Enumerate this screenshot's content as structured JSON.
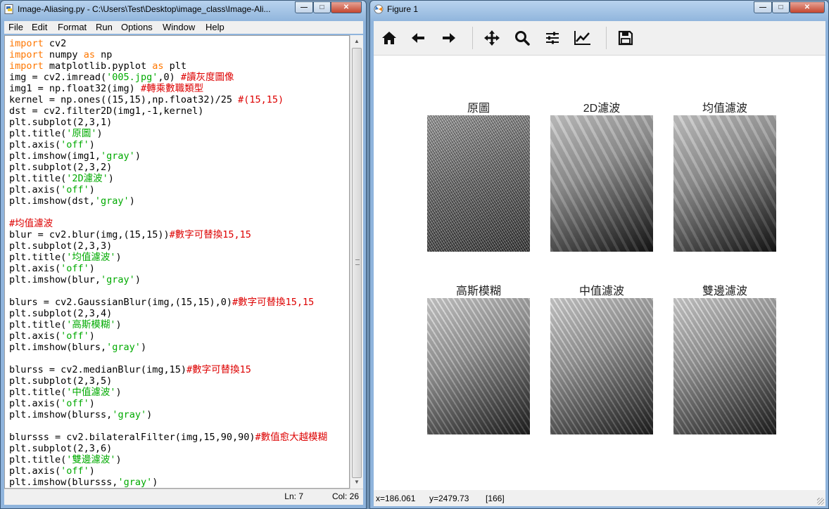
{
  "idle": {
    "title": "Image-Aliasing.py - C:\\Users\\Test\\Desktop\\image_class\\Image-Ali...",
    "menu": [
      "File",
      "Edit",
      "Format",
      "Run",
      "Options",
      "Window",
      "Help"
    ],
    "code_lines": [
      [
        [
          "kw",
          "import"
        ],
        [
          "n",
          " cv2"
        ]
      ],
      [
        [
          "kw",
          "import"
        ],
        [
          "n",
          " numpy "
        ],
        [
          "kw",
          "as"
        ],
        [
          "n",
          " np"
        ]
      ],
      [
        [
          "kw",
          "import"
        ],
        [
          "n",
          " matplotlib.pyplot "
        ],
        [
          "kw",
          "as"
        ],
        [
          "n",
          " plt"
        ]
      ],
      [
        [
          "n",
          "img = cv2.imread("
        ],
        [
          "str",
          "'005.jpg'"
        ],
        [
          "n",
          ",0) "
        ],
        [
          "cmt",
          "#讀灰度圖像"
        ]
      ],
      [
        [
          "n",
          "img1 = np.float32(img) "
        ],
        [
          "cmt",
          "#轉乘數職類型"
        ]
      ],
      [
        [
          "n",
          "kernel = np.ones((15,15),np.float32)/25 "
        ],
        [
          "cmt",
          "#(15,15)"
        ]
      ],
      [
        [
          "n",
          "dst = cv2.filter2D(img1,-1,kernel)"
        ]
      ],
      [
        [
          "n",
          "plt.subplot(2,3,1)"
        ]
      ],
      [
        [
          "n",
          "plt.title("
        ],
        [
          "str",
          "'原圖'"
        ],
        [
          "n",
          ")"
        ]
      ],
      [
        [
          "n",
          "plt.axis("
        ],
        [
          "str",
          "'off'"
        ],
        [
          "n",
          ")"
        ]
      ],
      [
        [
          "n",
          "plt.imshow(img1,"
        ],
        [
          "str",
          "'gray'"
        ],
        [
          "n",
          ")"
        ]
      ],
      [
        [
          "n",
          "plt.subplot(2,3,2)"
        ]
      ],
      [
        [
          "n",
          "plt.title("
        ],
        [
          "str",
          "'2D濾波'"
        ],
        [
          "n",
          ")"
        ]
      ],
      [
        [
          "n",
          "plt.axis("
        ],
        [
          "str",
          "'off'"
        ],
        [
          "n",
          ")"
        ]
      ],
      [
        [
          "n",
          "plt.imshow(dst,"
        ],
        [
          "str",
          "'gray'"
        ],
        [
          "n",
          ")"
        ]
      ],
      [
        [
          "n",
          ""
        ]
      ],
      [
        [
          "cmt",
          "#均值濾波"
        ]
      ],
      [
        [
          "n",
          "blur = cv2.blur(img,(15,15))"
        ],
        [
          "cmt",
          "#數字可替換15,15"
        ]
      ],
      [
        [
          "n",
          "plt.subplot(2,3,3)"
        ]
      ],
      [
        [
          "n",
          "plt.title("
        ],
        [
          "str",
          "'均值濾波'"
        ],
        [
          "n",
          ")"
        ]
      ],
      [
        [
          "n",
          "plt.axis("
        ],
        [
          "str",
          "'off'"
        ],
        [
          "n",
          ")"
        ]
      ],
      [
        [
          "n",
          "plt.imshow(blur,"
        ],
        [
          "str",
          "'gray'"
        ],
        [
          "n",
          ")"
        ]
      ],
      [
        [
          "n",
          ""
        ]
      ],
      [
        [
          "n",
          "blurs = cv2.GaussianBlur(img,(15,15),0)"
        ],
        [
          "cmt",
          "#數字可替換15,15"
        ]
      ],
      [
        [
          "n",
          "plt.subplot(2,3,4)"
        ]
      ],
      [
        [
          "n",
          "plt.title("
        ],
        [
          "str",
          "'高斯模糊'"
        ],
        [
          "n",
          ")"
        ]
      ],
      [
        [
          "n",
          "plt.axis("
        ],
        [
          "str",
          "'off'"
        ],
        [
          "n",
          ")"
        ]
      ],
      [
        [
          "n",
          "plt.imshow(blurs,"
        ],
        [
          "str",
          "'gray'"
        ],
        [
          "n",
          ")"
        ]
      ],
      [
        [
          "n",
          ""
        ]
      ],
      [
        [
          "n",
          "blurss = cv2.medianBlur(img,15)"
        ],
        [
          "cmt",
          "#數字可替換15"
        ]
      ],
      [
        [
          "n",
          "plt.subplot(2,3,5)"
        ]
      ],
      [
        [
          "n",
          "plt.title("
        ],
        [
          "str",
          "'中值濾波'"
        ],
        [
          "n",
          ")"
        ]
      ],
      [
        [
          "n",
          "plt.axis("
        ],
        [
          "str",
          "'off'"
        ],
        [
          "n",
          ")"
        ]
      ],
      [
        [
          "n",
          "plt.imshow(blurss,"
        ],
        [
          "str",
          "'gray'"
        ],
        [
          "n",
          ")"
        ]
      ],
      [
        [
          "n",
          ""
        ]
      ],
      [
        [
          "n",
          "blursss = cv2.bilateralFilter(img,15,90,90)"
        ],
        [
          "cmt",
          "#數值愈大越模糊"
        ]
      ],
      [
        [
          "n",
          "plt.subplot(2,3,6)"
        ]
      ],
      [
        [
          "n",
          "plt.title("
        ],
        [
          "str",
          "'雙邊濾波'"
        ],
        [
          "n",
          ")"
        ]
      ],
      [
        [
          "n",
          "plt.axis("
        ],
        [
          "str",
          "'off'"
        ],
        [
          "n",
          ")"
        ]
      ],
      [
        [
          "n",
          "plt.imshow(blursss,"
        ],
        [
          "str",
          "'gray'"
        ],
        [
          "n",
          ")"
        ]
      ]
    ],
    "status": {
      "line": "Ln: 7",
      "col": "Col: 26"
    }
  },
  "figure": {
    "title": "Figure 1",
    "toolbar_icons": [
      "home-icon",
      "back-arrow-icon",
      "forward-arrow-icon",
      "pan-move-icon",
      "zoom-magnifier-icon",
      "subplots-config-icon",
      "edit-axes-curve-icon",
      "save-floppy-icon"
    ],
    "subplots": [
      {
        "title": "原圖",
        "texture": "alias"
      },
      {
        "title": "2D濾波",
        "texture": "smooth"
      },
      {
        "title": "均值濾波",
        "texture": "smooth"
      },
      {
        "title": "高斯模糊",
        "texture": "gauss"
      },
      {
        "title": "中值濾波",
        "texture": "gauss"
      },
      {
        "title": "雙邊濾波",
        "texture": "gauss"
      }
    ],
    "status": {
      "x": "x=186.061",
      "y": "y=2479.73",
      "value": "[166]"
    }
  },
  "colors": {
    "keyword": "#ff7700",
    "string": "#00aa00",
    "comment": "#dd0000"
  }
}
